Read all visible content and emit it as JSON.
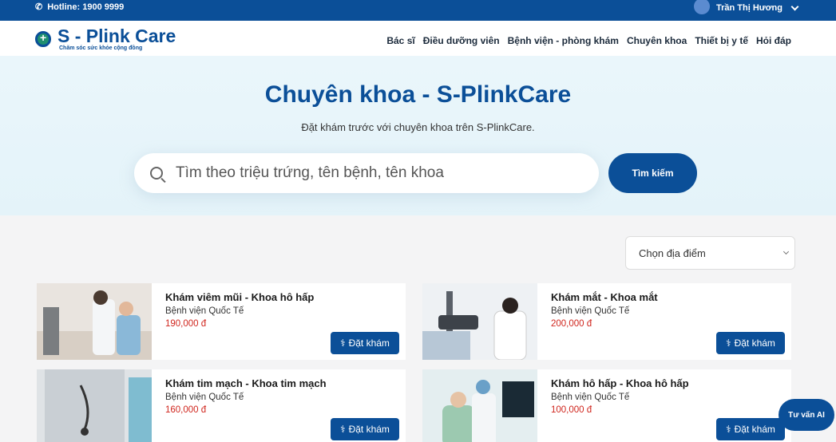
{
  "topbar": {
    "hotline": "Hotline: 1900 9999",
    "user_name": "Trần Thị Hương"
  },
  "logo": {
    "title": "S - Plink Care",
    "tagline": "Chăm sóc sức khỏe cộng đồng"
  },
  "nav": [
    "Bác sĩ",
    "Điều dưỡng viên",
    "Bệnh viện - phòng khám",
    "Chuyên khoa",
    "Thiết bị y tế",
    "Hỏi đáp"
  ],
  "hero": {
    "title": "Chuyên khoa - S-PlinkCare",
    "subtitle": "Đặt khám trước với chuyên khoa trên S-PlinkCare.",
    "search_placeholder": "Tìm theo triệu trứng, tên bệnh, tên khoa",
    "search_button": "Tìm kiếm"
  },
  "location_select": "Chọn địa điểm",
  "cards": [
    {
      "title": "Khám viêm mũi - Khoa hô hấp",
      "hospital": "Bệnh viện Quốc Tế",
      "price": "190,000 đ",
      "button": "Đặt khám"
    },
    {
      "title": "Khám mắt - Khoa mắt",
      "hospital": "Bệnh viện Quốc Tế",
      "price": "200,000 đ",
      "button": "Đặt khám"
    },
    {
      "title": "Khám tim mạch - Khoa tim mạch",
      "hospital": "Bệnh viện Quốc Tế",
      "price": "160,000 đ",
      "button": "Đặt khám"
    },
    {
      "title": "Khám hô hấp - Khoa hô hấp",
      "hospital": "Bệnh viện Quốc Tế",
      "price": "100,000 đ",
      "button": "Đặt khám"
    }
  ],
  "chat_button": "Tư vấn AI",
  "colors": {
    "brand": "#0b4f98",
    "price": "#d0261e",
    "hero_bg": "#e4f3f9"
  }
}
